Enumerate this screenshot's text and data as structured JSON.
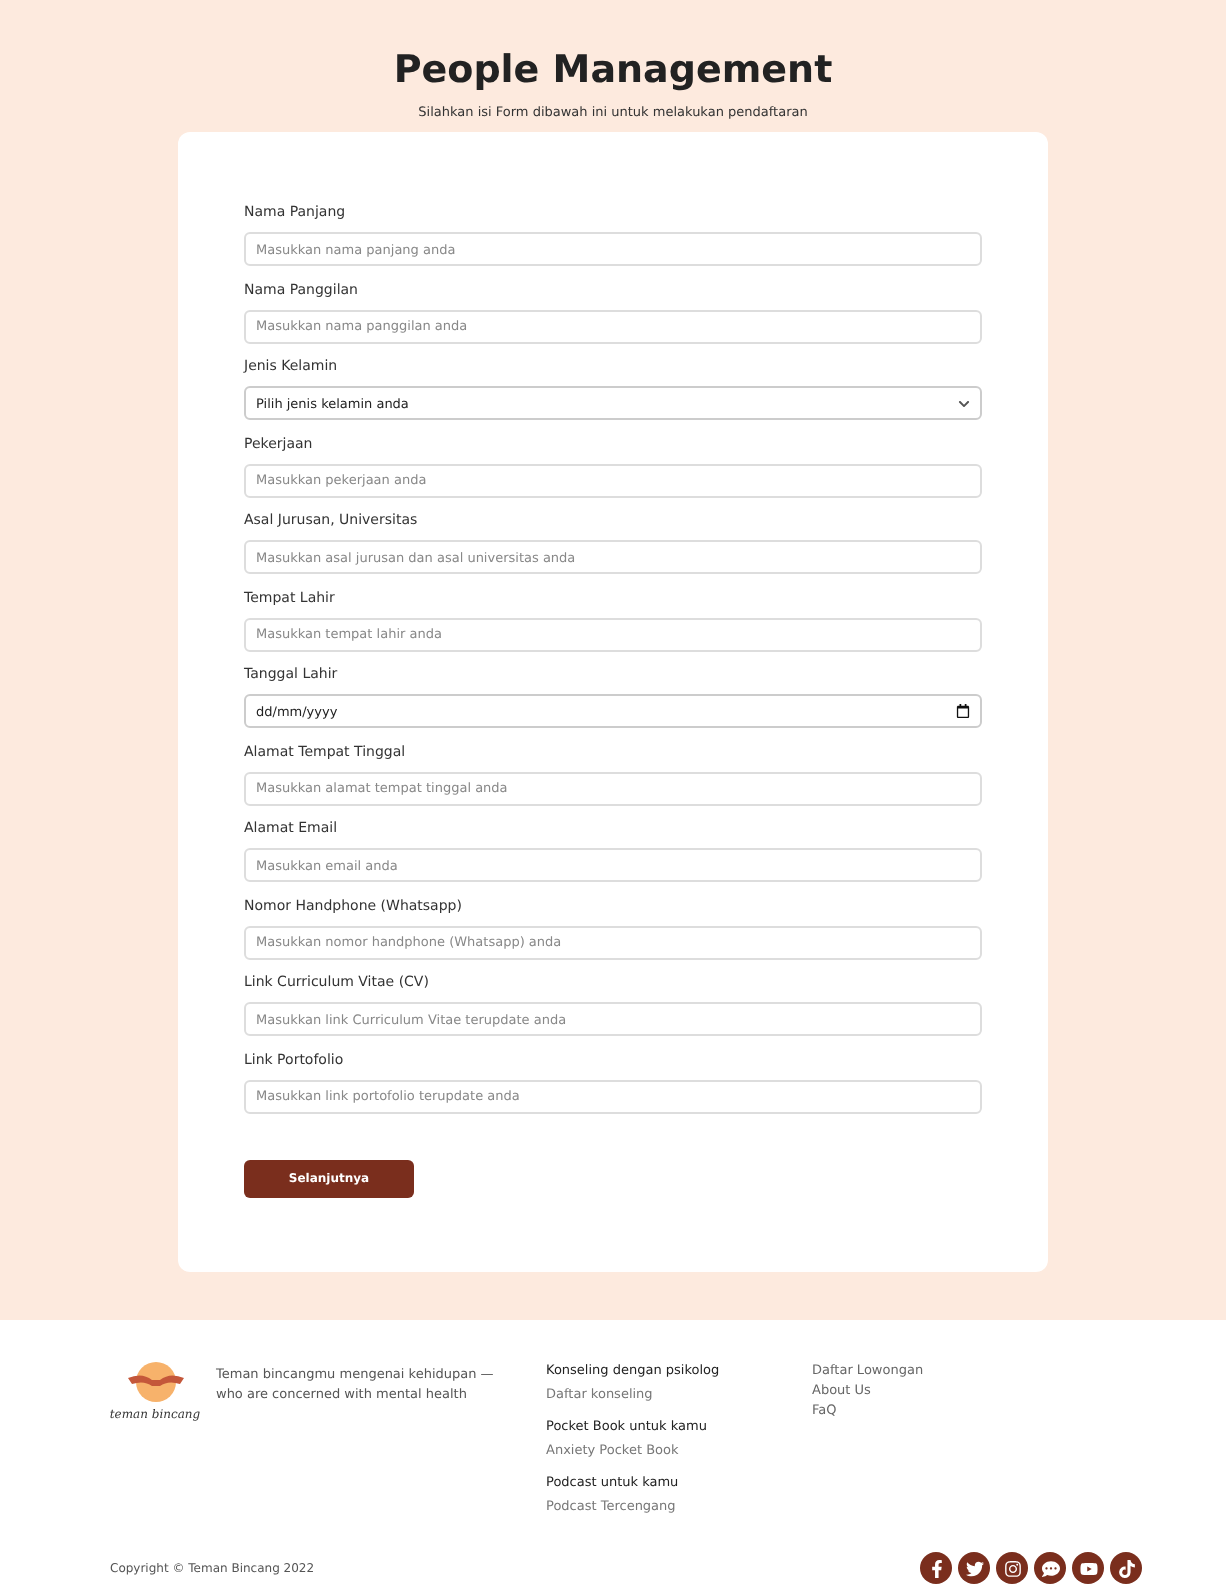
{
  "header": {
    "title": "People Management",
    "subtitle": "Silahkan isi Form dibawah ini untuk melakukan pendaftaran"
  },
  "form": {
    "fields": [
      {
        "kind": "input",
        "label": "Nama Panjang",
        "placeholder": "Masukkan nama panjang anda"
      },
      {
        "kind": "input",
        "label": "Nama Panggilan",
        "placeholder": "Masukkan nama panggilan anda"
      },
      {
        "kind": "select",
        "label": "Jenis Kelamin",
        "value": "Pilih jenis kelamin anda"
      },
      {
        "kind": "input",
        "label": "Pekerjaan",
        "placeholder": "Masukkan pekerjaan anda"
      },
      {
        "kind": "input",
        "label": "Asal Jurusan, Universitas",
        "placeholder": "Masukkan asal jurusan dan asal universitas anda"
      },
      {
        "kind": "input",
        "label": "Tempat Lahir",
        "placeholder": "Masukkan tempat lahir anda"
      },
      {
        "kind": "date",
        "label": "Tanggal Lahir",
        "value": "dd/mm/yyyy"
      },
      {
        "kind": "input",
        "label": "Alamat Tempat Tinggal",
        "placeholder": "Masukkan alamat tempat tinggal anda"
      },
      {
        "kind": "input",
        "label": "Alamat Email",
        "placeholder": "Masukkan email anda"
      },
      {
        "kind": "input",
        "label": "Nomor Handphone (Whatsapp)",
        "placeholder": "Masukkan nomor handphone (Whatsapp) anda"
      },
      {
        "kind": "input",
        "label": "Link Curriculum Vitae (CV)",
        "placeholder": "Masukkan link Curriculum Vitae terupdate anda"
      },
      {
        "kind": "input",
        "label": "Link Portofolio",
        "placeholder": "Masukkan link portofolio terupdate anda"
      }
    ],
    "submit": "Selanjutnya"
  },
  "footer": {
    "logo_text": "teman bincang",
    "tagline": "Teman bincangmu mengenai kehidupan — who are concerned with mental health",
    "sections": [
      {
        "heading": "Konseling dengan psikolog",
        "links": [
          "Daftar konseling"
        ]
      },
      {
        "heading": "Pocket Book untuk kamu",
        "links": [
          "Anxiety Pocket Book"
        ]
      },
      {
        "heading": "Podcast untuk kamu",
        "links": [
          "Podcast Tercengang"
        ]
      }
    ],
    "links": [
      "Daftar Lowongan",
      "About Us",
      "FaQ"
    ],
    "copyright": "Copyright © Teman Bincang 2022",
    "socials": [
      {
        "kind": "facebook"
      },
      {
        "kind": "twitter"
      },
      {
        "kind": "instagram"
      },
      {
        "kind": "chat"
      },
      {
        "kind": "youtube"
      },
      {
        "kind": "tiktok"
      }
    ]
  }
}
